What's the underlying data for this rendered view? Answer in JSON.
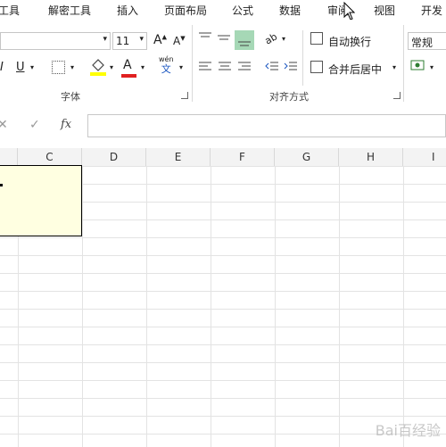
{
  "tabs": [
    "工具",
    "解密工具",
    "插入",
    "页面布局",
    "公式",
    "数据",
    "审阅",
    "视图",
    "开发"
  ],
  "font": {
    "size_value": "11",
    "increase_label": "A",
    "decrease_label": "A",
    "bold": "I",
    "underline": "U",
    "font_color_label": "A",
    "wen": "wén",
    "wen_char": "文",
    "group_label": "字体"
  },
  "align": {
    "wrap_label": "自动换行",
    "merge_label": "合并后居中",
    "group_label": "对齐方式",
    "orientation_label": "ab"
  },
  "number": {
    "format_value": "常规"
  },
  "formula": {
    "cancel": "✕",
    "confirm": "✓",
    "fx": "fx"
  },
  "columns": [
    "C",
    "D",
    "E",
    "F",
    "G",
    "H",
    "I"
  ],
  "watermark": "Bai百经验",
  "colors": {
    "accent_green": "#a6d8b6",
    "fill_yellow": "#ffff00",
    "font_red": "#e02020",
    "comment_bg": "#ffffe1"
  }
}
